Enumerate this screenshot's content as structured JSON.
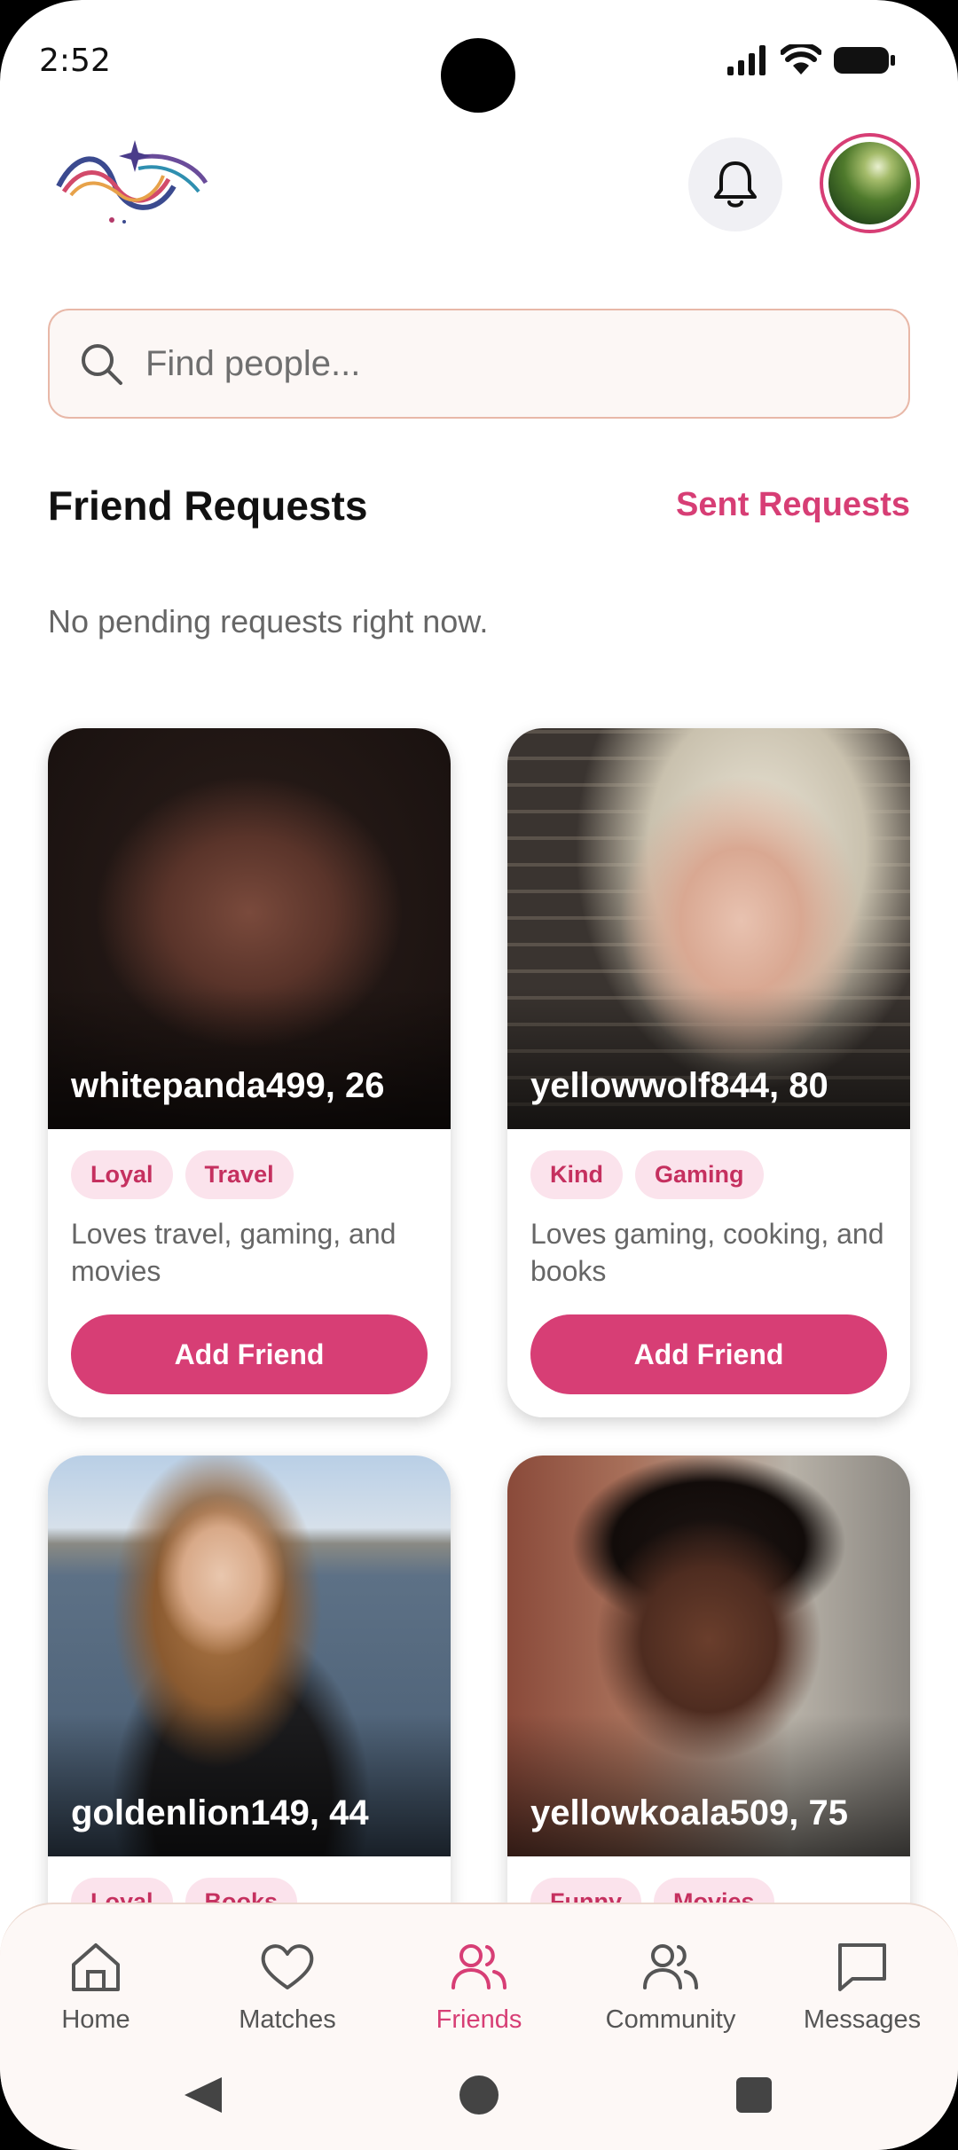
{
  "status_bar": {
    "time": "2:52"
  },
  "header": {
    "logo_icon": "yin-yang-swirl-logo",
    "notifications_icon": "bell-icon",
    "avatar_icon": "profile-avatar"
  },
  "search": {
    "placeholder": "Find people..."
  },
  "friend_requests": {
    "title": "Friend Requests",
    "sent_link": "Sent Requests",
    "empty_message": "No pending requests right now."
  },
  "cards": [
    {
      "name": "whitepanda499, 26",
      "tags": [
        "Loyal",
        "Travel"
      ],
      "bio": "Loves travel, gaming, and movies",
      "button": "Add Friend"
    },
    {
      "name": "yellowwolf844, 80",
      "tags": [
        "Kind",
        "Gaming"
      ],
      "bio": "Loves gaming, cooking, and books",
      "button": "Add Friend"
    },
    {
      "name": "goldenlion149, 44",
      "tags": [
        "Loyal",
        "Books"
      ],
      "bio": "",
      "button": ""
    },
    {
      "name": "yellowkoala509, 75",
      "tags": [
        "Funny",
        "Movies"
      ],
      "bio": "",
      "button": ""
    }
  ],
  "bottom_nav": [
    {
      "label": "Home",
      "icon": "home-icon",
      "active": false
    },
    {
      "label": "Matches",
      "icon": "heart-icon",
      "active": false
    },
    {
      "label": "Friends",
      "icon": "friends-icon",
      "active": true
    },
    {
      "label": "Community",
      "icon": "community-icon",
      "active": false
    },
    {
      "label": "Messages",
      "icon": "message-icon",
      "active": false
    }
  ],
  "colors": {
    "accent": "#d73e75",
    "tag_bg": "#fbe3ec"
  }
}
